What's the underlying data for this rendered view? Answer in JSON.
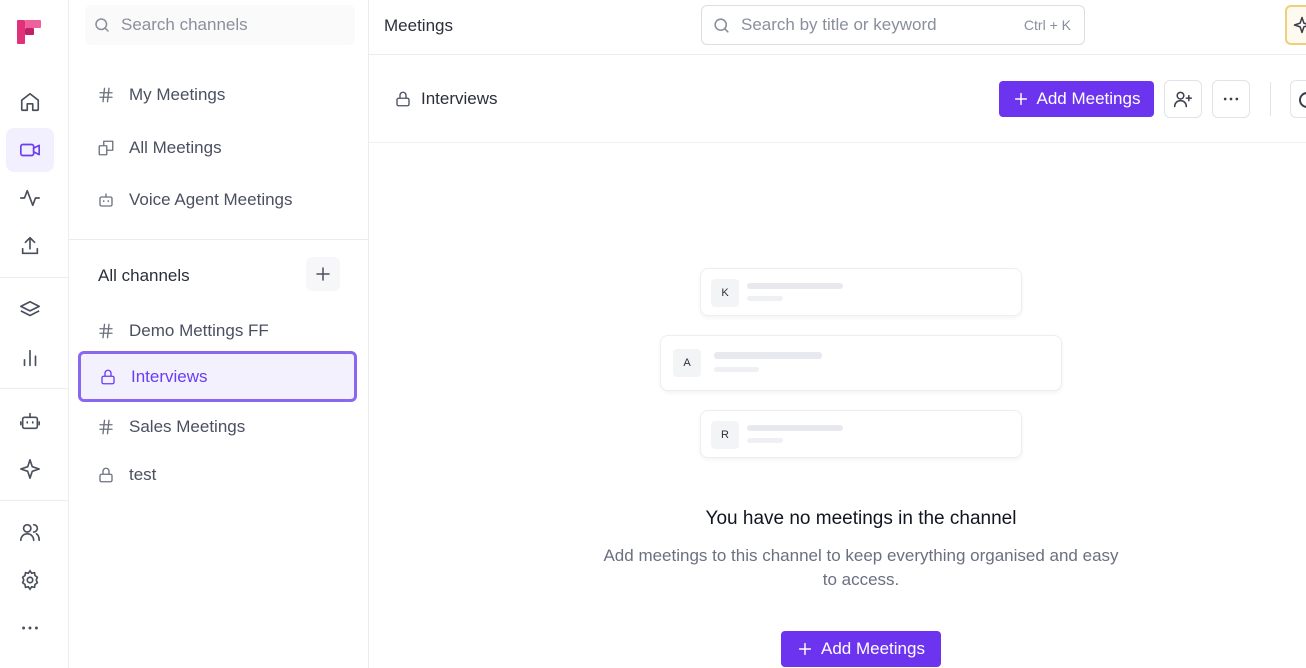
{
  "sidebar": {
    "search_placeholder": "Search channels",
    "quick_items": [
      {
        "label": "My Meetings",
        "icon": "hash-icon"
      },
      {
        "label": "All Meetings",
        "icon": "copy-icon"
      },
      {
        "label": "Voice Agent Meetings",
        "icon": "robot-icon"
      }
    ],
    "channels_title": "All channels",
    "channels": [
      {
        "label": "Demo Mettings FF",
        "icon": "hash-icon"
      },
      {
        "label": "Interviews",
        "icon": "lock-icon",
        "selected": true
      },
      {
        "label": "Sales Meetings",
        "icon": "hash-icon"
      },
      {
        "label": "test",
        "icon": "lock-icon"
      }
    ]
  },
  "topbar": {
    "title": "Meetings",
    "search_placeholder": "Search by title or keyword",
    "shortcut": "Ctrl + K"
  },
  "channel_header": {
    "name": "Interviews",
    "add_button": "Add Meetings"
  },
  "empty_state": {
    "cards": [
      "K",
      "A",
      "R"
    ],
    "title": "You have no meetings in the channel",
    "description": "Add meetings to this channel to keep everything organised and easy to access.",
    "add_button": "Add Meetings"
  },
  "colors": {
    "accent": "#6d34f0",
    "selected_border": "#8b67f0",
    "selected_bg": "#f4f1ff"
  }
}
